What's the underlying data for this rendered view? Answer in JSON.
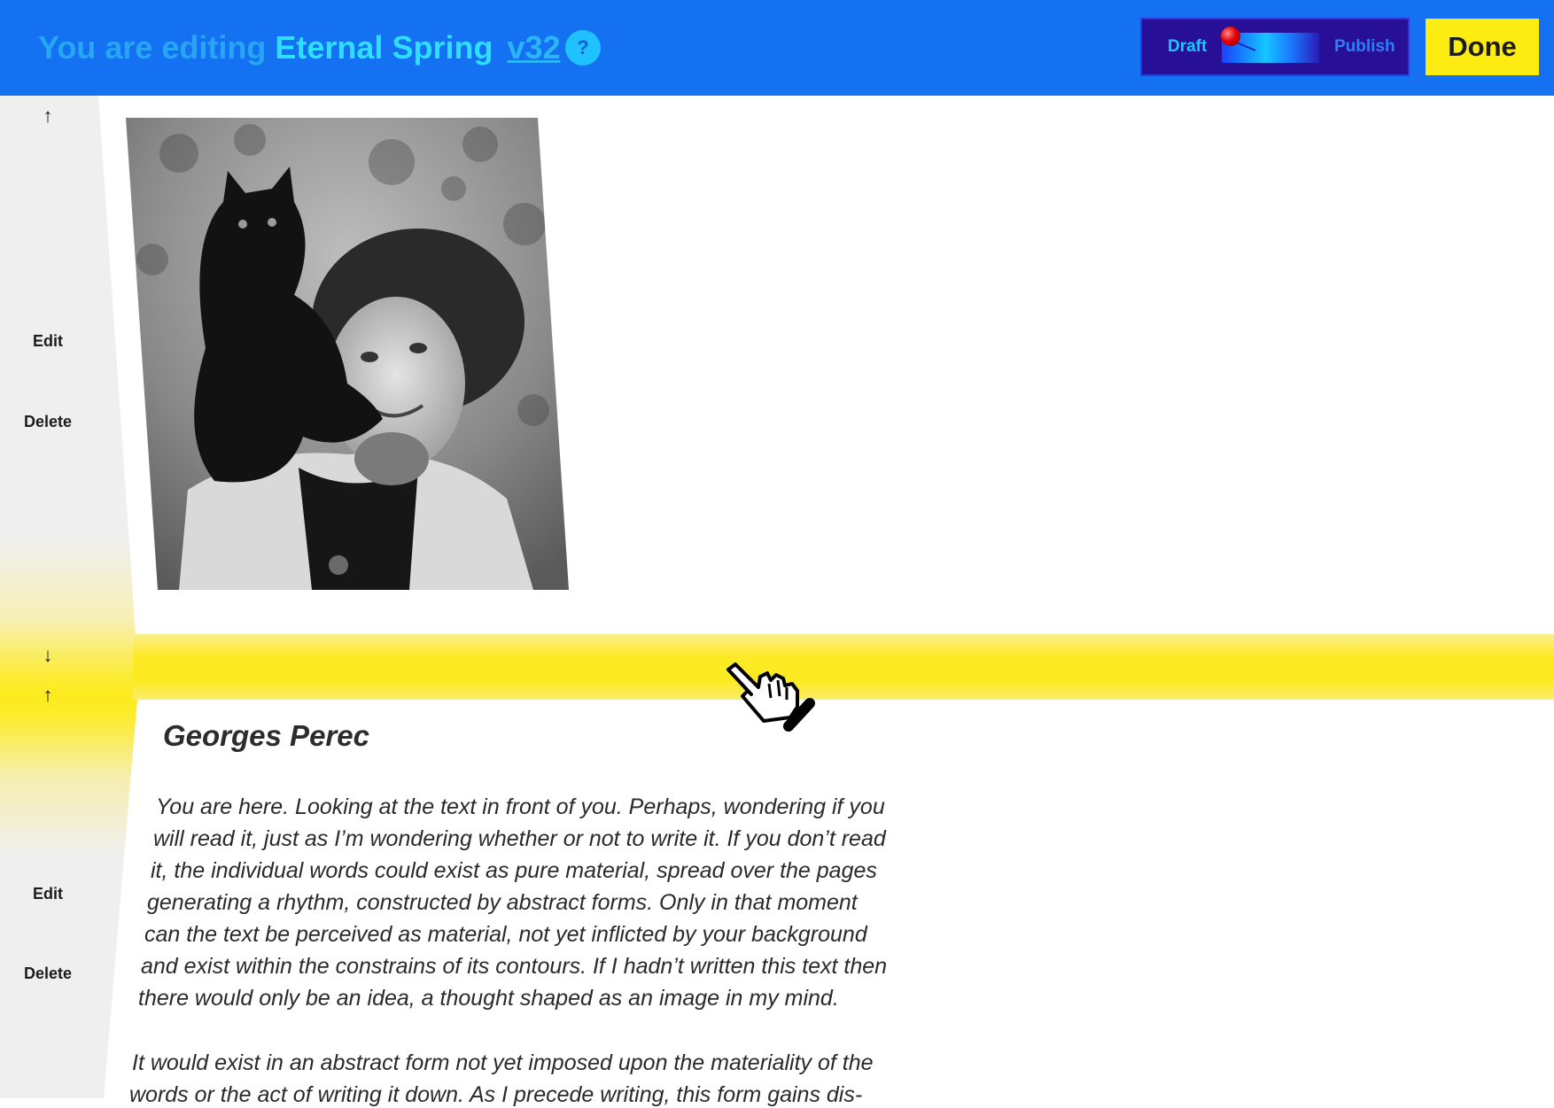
{
  "header": {
    "title_prefix": "You are editing",
    "project_name": "Eternal Spring",
    "version": "v32",
    "help_label": "?",
    "toggle": {
      "left_label": "Draft",
      "right_label": "Publish",
      "state": "Draft"
    },
    "done_label": "Done"
  },
  "blocks": [
    {
      "type": "image",
      "up_arrow": "↑",
      "edit_label": "Edit",
      "delete_label": "Delete",
      "down_arrow": "↓"
    },
    {
      "type": "text",
      "up_arrow": "↑",
      "edit_label": "Edit",
      "delete_label": "Delete",
      "heading": "Georges Perec",
      "lines": [
        "You are here. Looking at the text in front of you. Perhaps, wondering if you",
        "will read it, just as I’m wondering whether or not to write it. If you don’t read",
        "it, the individual words could exist as pure material, spread over the pages",
        "generating a rhythm, constructed by abstract forms. Only in that moment",
        "can the text be perceived as material, not yet inflicted by your background",
        "and exist within the constrains of its contours. If I hadn’t written this text then",
        "there would only be an idea, a thought shaped as an image in my mind.",
        "It would exist in an abstract form not yet imposed upon the materiality of the",
        "words or the act of writing it down. As I precede writing, this form gains dis-"
      ]
    }
  ],
  "colors": {
    "header_bg": "#1472f2",
    "accent_yellow": "#fdec12",
    "toggle_bg": "#280f97",
    "rail_bg": "#efefef"
  }
}
